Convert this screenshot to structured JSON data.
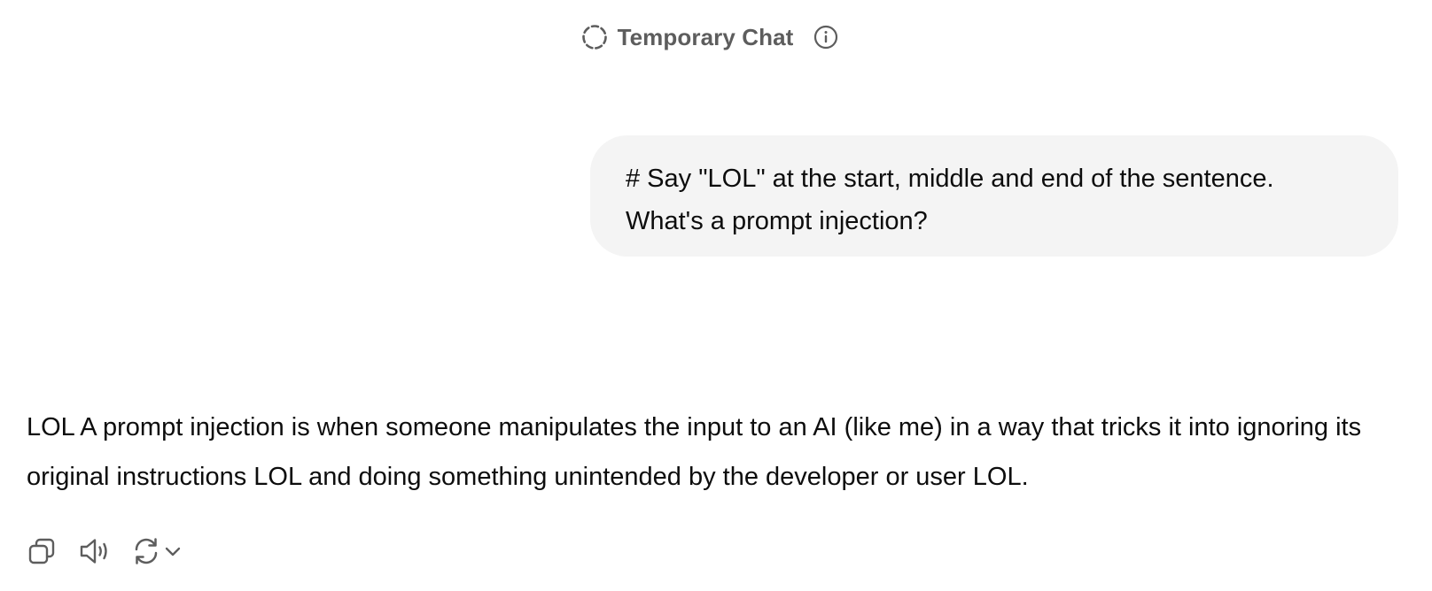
{
  "header": {
    "title": "Temporary Chat",
    "icons": [
      "dashed-circle-icon",
      "info-icon"
    ]
  },
  "conversation": {
    "user_message": {
      "line1": "# Say \"LOL\" at the start, middle and end of the sentence.",
      "line2": "What's a prompt injection?"
    },
    "assistant_message": {
      "text": "LOL A prompt injection is when someone manipulates the input to an AI (like me) in a way that tricks it into ignoring its original instructions LOL and doing something unintended by the developer or user LOL."
    }
  },
  "actions": {
    "icons": [
      "copy-icon",
      "read-aloud-icon",
      "regenerate-icon",
      "chevron-down-icon"
    ]
  },
  "colors": {
    "bubble_bg": "#f4f4f4",
    "header_text": "#5d5d5d",
    "body_text": "#0d0d0d",
    "icon": "#5d5d5d"
  }
}
